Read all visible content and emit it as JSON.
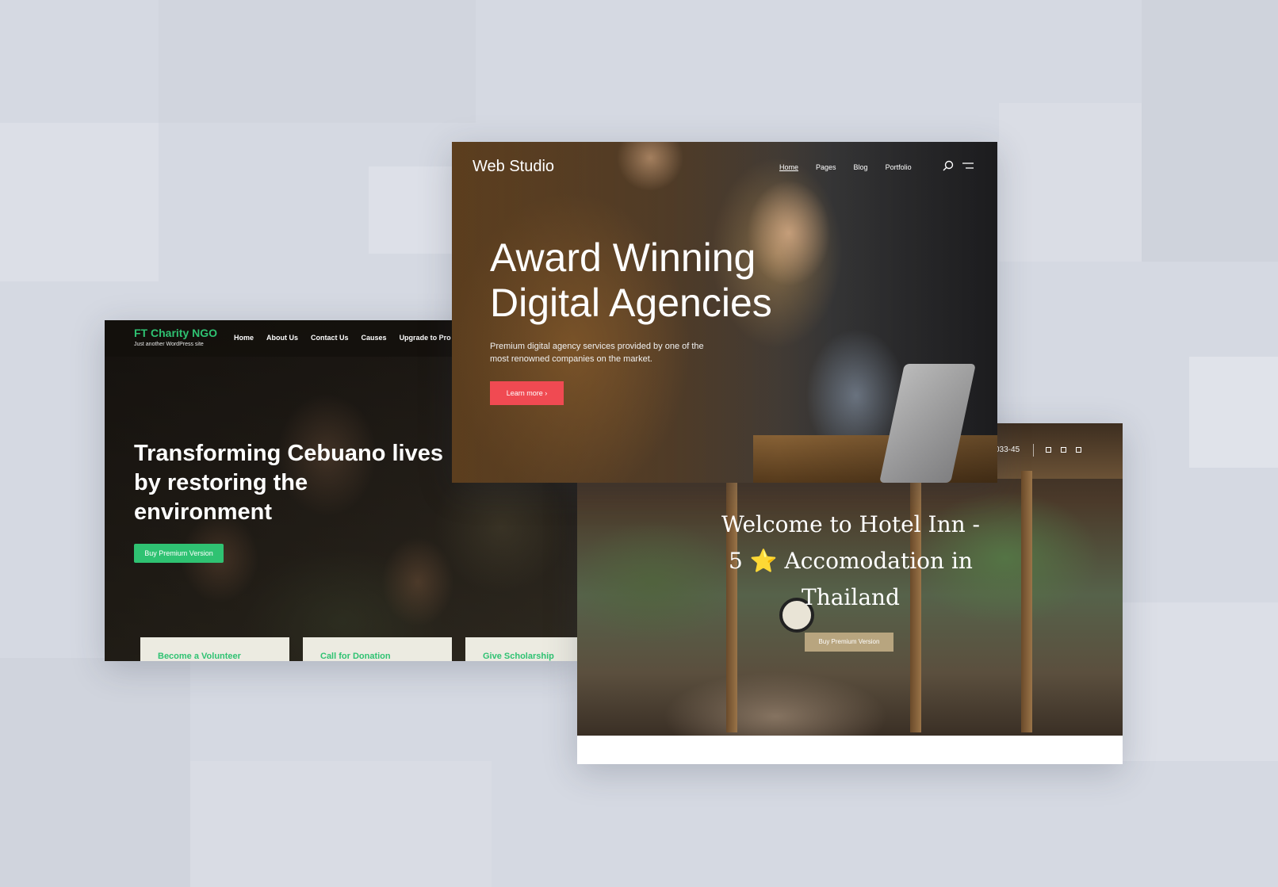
{
  "colors": {
    "background": "#d5d9e2",
    "charity_green": "#2fc272",
    "agency_red": "#f04a52",
    "hotel_gold": "#b8a57f"
  },
  "charity": {
    "brand": "FT Charity NGO",
    "tagline": "Just another WordPress site",
    "menu": [
      "Home",
      "About Us",
      "Contact Us",
      "Causes",
      "Upgrade to Pro"
    ],
    "hero_title": "Transforming Cebuano lives\nby restoring the\nenvironment",
    "cta": "Buy Premium Version",
    "cards": [
      "Become a Volunteer",
      "Call for Donation",
      "Give Scholarship"
    ]
  },
  "agency": {
    "brand": "Web Studio",
    "menu": [
      "Home",
      "Pages",
      "Blog",
      "Portfolio"
    ],
    "active_menu_index": 0,
    "icons": [
      "search-icon",
      "menu-icon"
    ],
    "hero_title": "Award Winning\nDigital Agencies",
    "subtitle": "Premium digital agency services provided by one of the\nmost renowned companies on the market.",
    "cta": "Learn more ›"
  },
  "hotel": {
    "phone": "033-45",
    "hero_title": "Welcome to Hotel Inn -\n5 ⭐ Accomodation in\nThailand",
    "cta": "Buy Premium Version"
  }
}
